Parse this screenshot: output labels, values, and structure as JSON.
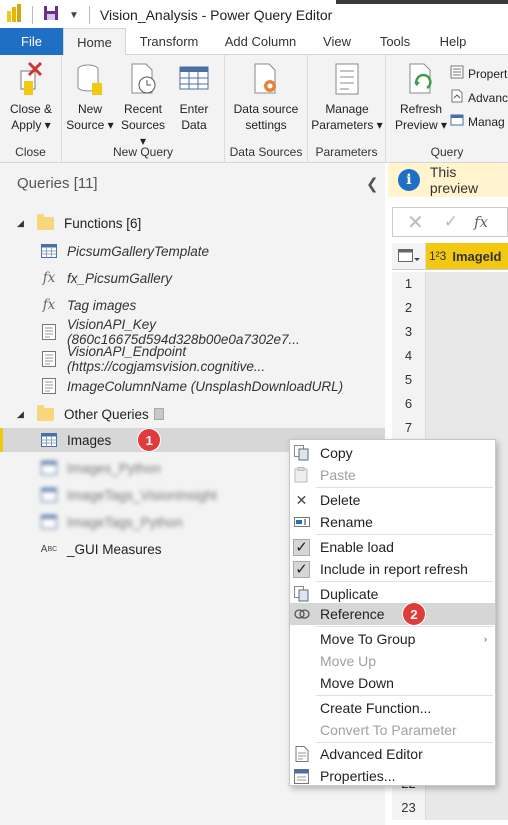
{
  "window": {
    "title": "Vision_Analysis - Power Query Editor"
  },
  "tabs": [
    "File",
    "Home",
    "Transform",
    "Add Column",
    "View",
    "Tools",
    "Help"
  ],
  "ribbon": {
    "close_apply": {
      "line1": "Close &",
      "line2": "Apply",
      "group": "Close"
    },
    "new_source": {
      "line1": "New",
      "line2": "Source"
    },
    "recent_sources": {
      "line1": "Recent",
      "line2": "Sources"
    },
    "enter_data": {
      "line1": "Enter",
      "line2": "Data"
    },
    "new_query_group": "New Query",
    "data_source_settings": {
      "line1": "Data source",
      "line2": "settings",
      "group": "Data Sources"
    },
    "manage_parameters": {
      "line1": "Manage",
      "line2": "Parameters",
      "group": "Parameters"
    },
    "refresh_preview": {
      "line1": "Refresh",
      "line2": "Preview"
    },
    "properties": "Propert",
    "advanced": "Advanc",
    "manage": "Manag",
    "query_group": "Query"
  },
  "queries": {
    "header": "Queries [11]",
    "functions_folder": "Functions [6]",
    "functions": [
      {
        "label": "PicsumGalleryTemplate",
        "icon": "table"
      },
      {
        "label": "fx_PicsumGallery",
        "icon": "fx"
      },
      {
        "label": "Tag images",
        "icon": "fx"
      },
      {
        "label": "VisionAPI_Key (860c16675d594d328b00e0a7302e7...",
        "icon": "param"
      },
      {
        "label": "VisionAPI_Endpoint (https://cogjamsvision.cognitive...",
        "icon": "param"
      },
      {
        "label": "ImageColumnName (UnsplashDownloadURL)",
        "icon": "param"
      }
    ],
    "other_folder": "Other Queries",
    "other": [
      {
        "label": "Images",
        "icon": "table"
      },
      {
        "label": "Images_Python",
        "icon": "table"
      },
      {
        "label": "ImageTags_VisionInsight",
        "icon": "table"
      },
      {
        "label": "ImageTags_Python",
        "icon": "table"
      },
      {
        "label": "_GUI Measures",
        "icon": "abc"
      }
    ]
  },
  "badges": {
    "one": "1",
    "two": "2"
  },
  "preview": {
    "info_text": "This preview",
    "column_type": "1²3",
    "column_name": "ImageId",
    "rows": [
      "1",
      "2",
      "3",
      "4",
      "5",
      "6",
      "7"
    ],
    "last_rows": [
      "22",
      "23"
    ]
  },
  "context_menu": {
    "items": [
      "Copy",
      "Paste",
      "Delete",
      "Rename",
      "Enable load",
      "Include in report refresh",
      "Duplicate",
      "Reference",
      "Move To Group",
      "Move Up",
      "Move Down",
      "Create Function...",
      "Convert To Parameter",
      "Advanced Editor",
      "Properties..."
    ]
  },
  "colors": {
    "file_tab": "#1f6fc5",
    "badge": "#e03b3b",
    "accent": "#f2c811"
  }
}
